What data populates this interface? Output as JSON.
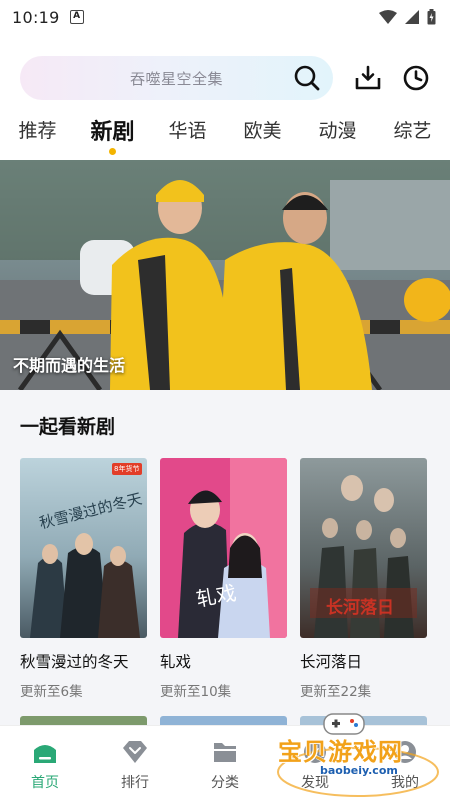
{
  "status_bar": {
    "time": "10:19",
    "badge": "A"
  },
  "search": {
    "placeholder": "吞噬星空全集"
  },
  "tabs": [
    {
      "label": "推荐"
    },
    {
      "label": "新剧",
      "active": true
    },
    {
      "label": "华语"
    },
    {
      "label": "欧美"
    },
    {
      "label": "动漫"
    },
    {
      "label": "综艺"
    }
  ],
  "banner": {
    "caption": "不期而遇的生活"
  },
  "section": {
    "title": "一起看新剧",
    "items": [
      {
        "title": "秋雪漫过的冬天",
        "subtitle": "更新至6集",
        "poster_text": "秋雪漫过的冬天",
        "poster_badge": "8年货节"
      },
      {
        "title": "轧戏",
        "subtitle": "更新至10集",
        "poster_text": "轧戏"
      },
      {
        "title": "长河落日",
        "subtitle": "更新至22集",
        "poster_text": "长河落日"
      }
    ]
  },
  "bottom_nav": [
    {
      "label": "首页",
      "icon": "home-icon",
      "active": true
    },
    {
      "label": "排行",
      "icon": "diamond-icon"
    },
    {
      "label": "分类",
      "icon": "folder-icon"
    },
    {
      "label": "发现",
      "icon": "discover-icon"
    },
    {
      "label": "我的",
      "icon": "user-icon"
    }
  ],
  "watermark": {
    "text": "宝贝游戏网",
    "url": "baobeiy.com"
  },
  "colors": {
    "accent": "#2aa876",
    "tab_dot": "#f3b400",
    "section_bg": "#f4f5f8"
  }
}
